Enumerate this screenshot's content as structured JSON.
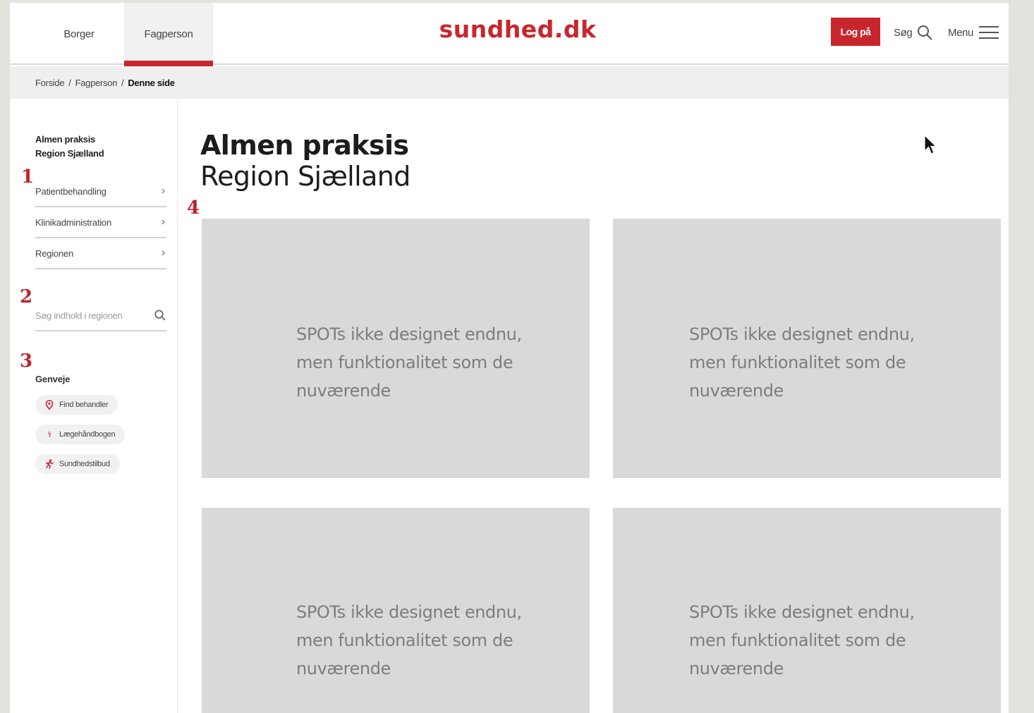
{
  "header": {
    "tabs": [
      {
        "label": "Borger"
      },
      {
        "label": "Fagperson"
      }
    ],
    "logo": "sundhed.dk",
    "login_label": "Log på",
    "search_label": "Søg",
    "menu_label": "Menu"
  },
  "breadcrumb": {
    "items": [
      "Forside",
      "Fagperson"
    ],
    "current": "Denne side",
    "separator": "/"
  },
  "sidebar": {
    "title_line1": "Almen praksis",
    "title_line2": "Region Sjælland",
    "nav": [
      {
        "label": "Patientbehandling"
      },
      {
        "label": "Klinikadministration"
      },
      {
        "label": "Regionen"
      }
    ],
    "search_placeholder": "Søg indhold i regionen",
    "shortcuts_heading": "Genveje",
    "shortcuts": [
      {
        "label": "Find behandler",
        "icon": "location-pin-icon"
      },
      {
        "label": "Lægehåndbogen",
        "icon": "caduceus-icon"
      },
      {
        "label": "Sundhedstilbud",
        "icon": "runner-icon"
      }
    ]
  },
  "markers": [
    "1",
    "2",
    "3",
    "4"
  ],
  "main": {
    "title": "Almen praksis",
    "subtitle": "Region Sjælland",
    "spots": [
      {
        "line1": "SPOTs ikke designet endnu,",
        "line2": "men funktionalitet som de",
        "line3": "nuværende"
      },
      {
        "line1": "SPOTs ikke designet endnu,",
        "line2": "men funktionalitet som de",
        "line3": "nuværende"
      },
      {
        "line1": "SPOTs ikke designet endnu,",
        "line2": "men funktionalitet som de",
        "line3": "nuværende"
      },
      {
        "line1": "SPOTs ikke designet endnu,",
        "line2": "men funktionalitet som de",
        "line3": "nuværende"
      }
    ]
  },
  "colors": {
    "brand": "#c8262c",
    "spot_bg": "#d9d9d9",
    "spot_text": "#7d7d7d"
  }
}
